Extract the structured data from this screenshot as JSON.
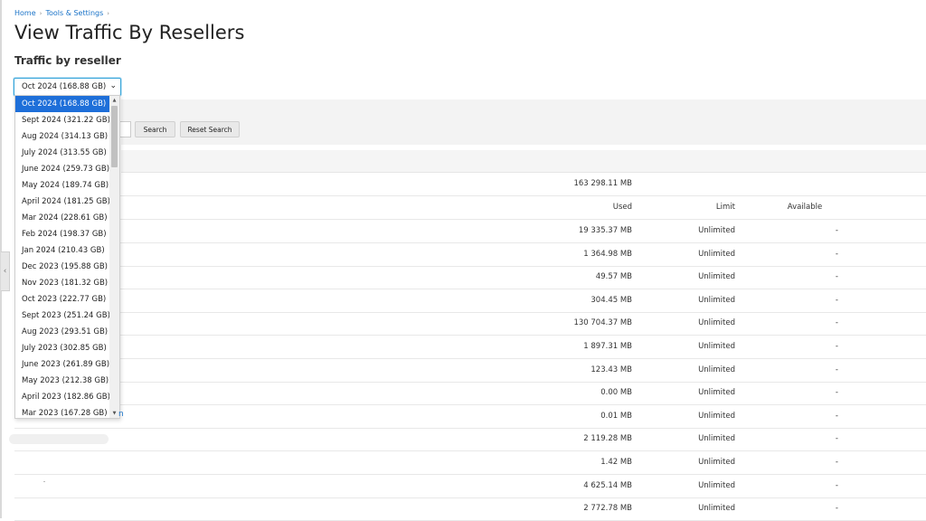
{
  "breadcrumb": {
    "home": "Home",
    "tools": "Tools & Settings"
  },
  "page": {
    "title": "View Traffic By Resellers",
    "section_title": "Traffic by reseller"
  },
  "period_select": {
    "selected": "Oct 2024 (168.88 GB)",
    "options": [
      "Oct 2024 (168.88 GB)",
      "Sept 2024 (321.22 GB)",
      "Aug 2024 (314.13 GB)",
      "July 2024 (313.55 GB)",
      "June 2024 (259.73 GB)",
      "May 2024 (189.74 GB)",
      "April 2024 (181.25 GB)",
      "Mar 2024 (228.61 GB)",
      "Feb 2024 (198.37 GB)",
      "Jan 2024 (210.43 GB)",
      "Dec 2023 (195.88 GB)",
      "Nov 2023 (181.32 GB)",
      "Oct 2023 (222.77 GB)",
      "Sept 2023 (251.24 GB)",
      "Aug 2023 (293.51 GB)",
      "July 2023 (302.85 GB)",
      "June 2023 (261.89 GB)",
      "May 2023 (212.38 GB)",
      "April 2023 (182.86 GB)",
      "Mar 2023 (167.28 GB)"
    ]
  },
  "search": {
    "button": "Search",
    "reset": "Reset Search"
  },
  "table": {
    "total_used": "163 298.11 MB",
    "headers": {
      "used": "Used",
      "limit": "Limit",
      "available": "Available"
    },
    "rows": [
      {
        "used": "19 335.37 MB",
        "limit": "Unlimited",
        "available": "-"
      },
      {
        "used": "1 364.98 MB",
        "limit": "Unlimited",
        "available": "-"
      },
      {
        "used": "49.57 MB",
        "limit": "Unlimited",
        "available": "-"
      },
      {
        "used": "304.45 MB",
        "limit": "Unlimited",
        "available": "-"
      },
      {
        "used": "130 704.37 MB",
        "limit": "Unlimited",
        "available": "-"
      },
      {
        "used": "1 897.31 MB",
        "limit": "Unlimited",
        "available": "-"
      },
      {
        "used": "123.43 MB",
        "limit": "Unlimited",
        "available": "-"
      },
      {
        "used": "0.00 MB",
        "limit": "Unlimited",
        "available": "-"
      },
      {
        "used": "0.01 MB",
        "limit": "Unlimited",
        "available": "-"
      },
      {
        "used": "2 119.28 MB",
        "limit": "Unlimited",
        "available": "-"
      },
      {
        "used": "1.42 MB",
        "limit": "Unlimited",
        "available": "-"
      },
      {
        "used": "4 625.14 MB",
        "limit": "Unlimited",
        "available": "-"
      },
      {
        "used": "2 772.78 MB",
        "limit": "Unlimited",
        "available": "-"
      }
    ]
  },
  "icons": {
    "chevron_down": "chevron-down-icon",
    "chevron_left": "chevron-left-icon",
    "breadcrumb_sep": "chevron-right-icon"
  }
}
